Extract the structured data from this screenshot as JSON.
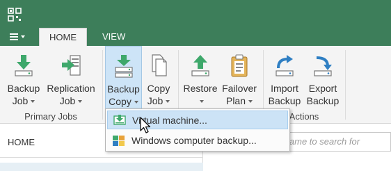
{
  "tabs": {
    "home": "HOME",
    "view": "VIEW"
  },
  "ribbon": {
    "backup_job": {
      "line1": "Backup",
      "line2": "Job"
    },
    "replication_job": {
      "line1": "Replication",
      "line2": "Job"
    },
    "backup_copy": {
      "line1": "Backup",
      "line2": "Copy"
    },
    "copy_job": {
      "line1": "Copy",
      "line2": "Job"
    },
    "restore": {
      "line1": "Restore",
      "line2": ""
    },
    "failover_plan": {
      "line1": "Failover",
      "line2": "Plan"
    },
    "import_backup": {
      "line1": "Import",
      "line2": "Backup"
    },
    "export_backup": {
      "line1": "Export",
      "line2": "Backup"
    },
    "groups": {
      "primary_jobs": "Primary Jobs",
      "actions": "Actions"
    }
  },
  "dropdown": {
    "items": [
      "Virtual machine...",
      "Windows computer backup..."
    ]
  },
  "navigation": {
    "title": "HOME"
  },
  "search": {
    "placeholder": "Type in an object name to search for"
  },
  "colors": {
    "titlebar": "#3d7e5a",
    "icon_green": "#3ea86b",
    "icon_blue": "#2f7fc3",
    "hover": "#cce3f6"
  }
}
